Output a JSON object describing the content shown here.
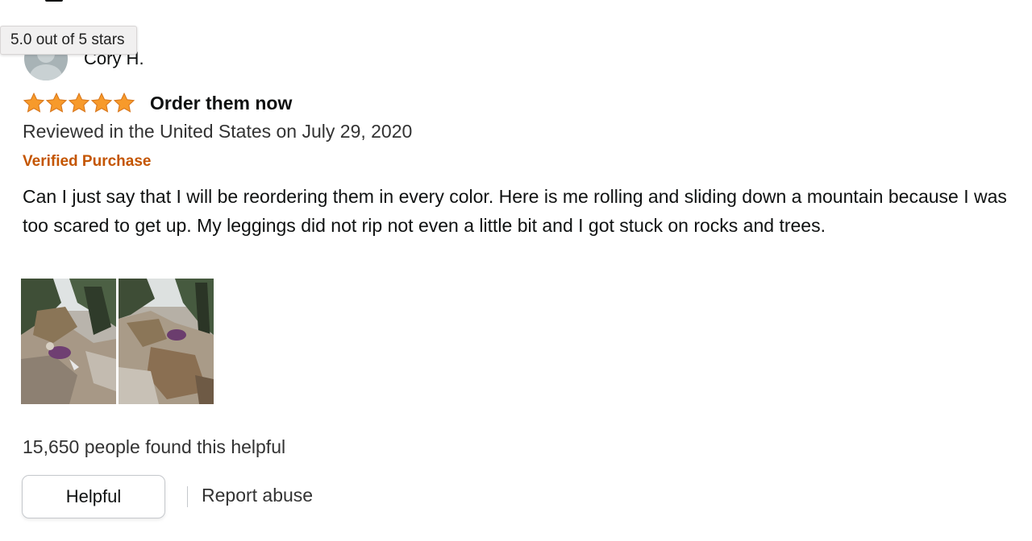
{
  "tooltip": {
    "text": "5.0 out of 5 stars"
  },
  "review": {
    "reviewer_name": "Cory H.",
    "rating": 5,
    "rating_max": 5,
    "title": "Order them now",
    "date_text": "Reviewed in the United States on July 29, 2020",
    "verified_label": "Verified Purchase",
    "body": "Can I just say that I will be reordering them in every color. Here is me rolling and sliding down a mountain because I was too scared to get up. My leggings did not rip not even a little bit and I got stuck on rocks and trees.",
    "image_count": 2
  },
  "footer": {
    "helpful_count_text": "15,650 people found this helpful",
    "helpful_button_label": "Helpful",
    "report_link_label": "Report abuse"
  },
  "colors": {
    "star": "#f79a2b",
    "verified": "#c45500",
    "text": "#0f1111"
  },
  "icons": [
    "avatar-icon",
    "star-icon"
  ]
}
